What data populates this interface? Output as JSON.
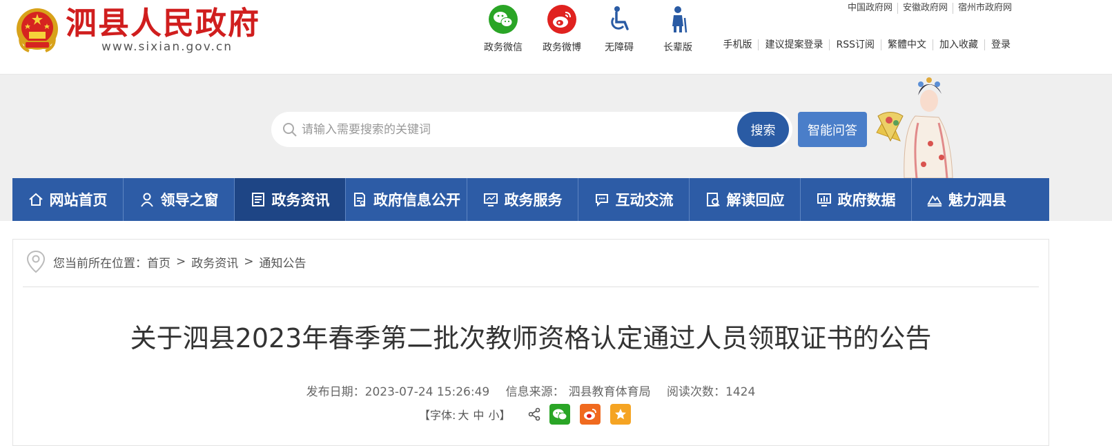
{
  "header": {
    "site_title": "泗县人民政府",
    "domain": "www.sixian.gov.cn",
    "quick_links": [
      {
        "label": "政务微信",
        "icon": "wechat-icon",
        "color": "#2aa526"
      },
      {
        "label": "政务微博",
        "icon": "weibo-icon",
        "color": "#e0221f"
      },
      {
        "label": "无障碍",
        "icon": "wheelchair-icon",
        "color": "#2a5ba4"
      },
      {
        "label": "长辈版",
        "icon": "elderly-icon",
        "color": "#2a5ba4"
      }
    ],
    "top_links": [
      "中国政府网",
      "安徽政府网",
      "宿州市政府网"
    ],
    "util_links": [
      "手机版",
      "建议提案登录",
      "RSS订阅",
      "繁體中文",
      "加入收藏",
      "登录"
    ]
  },
  "search": {
    "placeholder": "请输入需要搜索的关键词",
    "button": "搜索",
    "ai_button": "智能问答"
  },
  "nav": {
    "items": [
      {
        "label": "网站首页",
        "icon": "home-icon"
      },
      {
        "label": "领导之窗",
        "icon": "person-icon"
      },
      {
        "label": "政务资讯",
        "icon": "news-icon",
        "active": true
      },
      {
        "label": "政府信息公开",
        "icon": "document-icon"
      },
      {
        "label": "政务服务",
        "icon": "monitor-icon"
      },
      {
        "label": "互动交流",
        "icon": "chat-icon"
      },
      {
        "label": "解读回应",
        "icon": "read-icon"
      },
      {
        "label": "政府数据",
        "icon": "chart-icon"
      },
      {
        "label": "魅力泗县",
        "icon": "scenery-icon"
      }
    ]
  },
  "breadcrumb": {
    "prefix": "您当前所在位置：",
    "items": [
      "首页",
      "政务资讯",
      "通知公告"
    ],
    "separator": ">"
  },
  "article": {
    "title": "关于泗县2023年春季第二批次教师资格认定通过人员领取证书的公告",
    "publish_label": "发布日期：",
    "publish_date": "2023-07-24 15:26:49",
    "source_label": "信息来源：",
    "source": "泗县教育体育局",
    "views_label": "阅读次数：",
    "views": "1424",
    "font_label": "【字体:",
    "font_large": "大",
    "font_medium": "中",
    "font_small": "小】"
  },
  "colors": {
    "brand_red": "#d01e1e",
    "nav_blue": "#2d5ca6",
    "nav_active": "#1e4585"
  }
}
